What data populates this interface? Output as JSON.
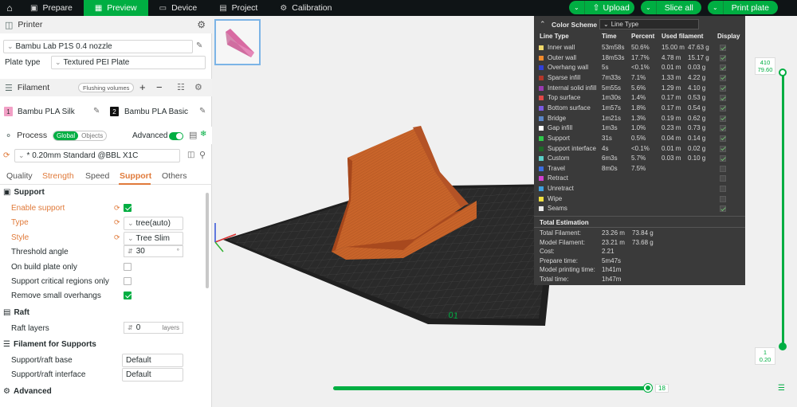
{
  "topbar": {
    "tabs": [
      {
        "label": "Prepare",
        "icon": "cube-icon"
      },
      {
        "label": "Preview",
        "icon": "preview-icon",
        "active": true
      },
      {
        "label": "Device",
        "icon": "monitor-icon"
      },
      {
        "label": "Project",
        "icon": "project-icon"
      },
      {
        "label": "Calibration",
        "icon": "gear-icon"
      }
    ],
    "upload_label": "Upload",
    "slice_label": "Slice all",
    "print_label": "Print plate"
  },
  "printer": {
    "section_title": "Printer",
    "printer_name": "Bambu Lab P1S 0.4 nozzle",
    "plate_label": "Plate type",
    "plate_value": "Textured PEI Plate"
  },
  "filament": {
    "section_title": "Filament",
    "flushing_label": "Flushing volumes",
    "items": [
      {
        "index": "1",
        "name": "Bambu PLA Silk",
        "color": "#f2a0c6"
      },
      {
        "index": "2",
        "name": "Bambu PLA Basic",
        "color": "#111111"
      }
    ]
  },
  "process": {
    "section_title": "Process",
    "global_label": "Global",
    "objects_label": "Objects",
    "advanced_label": "Advanced",
    "preset": "* 0.20mm Standard @BBL X1C"
  },
  "tabs": [
    "Quality",
    "Strength",
    "Speed",
    "Support",
    "Others"
  ],
  "support": {
    "title": "Support",
    "enable_label": "Enable support",
    "type_label": "Type",
    "type_value": "tree(auto)",
    "style_label": "Style",
    "style_value": "Tree Slim",
    "threshold_label": "Threshold angle",
    "threshold_value": "30",
    "threshold_unit": "°",
    "on_plate_label": "On build plate only",
    "critical_label": "Support critical regions only",
    "remove_label": "Remove small overhangs"
  },
  "raft": {
    "title": "Raft",
    "layers_label": "Raft layers",
    "layers_value": "0",
    "layers_unit": "layers"
  },
  "filament_supports": {
    "title": "Filament for Supports",
    "base_label": "Support/raft base",
    "base_value": "Default",
    "interface_label": "Support/raft interface",
    "interface_value": "Default"
  },
  "advanced_section": {
    "title": "Advanced"
  },
  "color_scheme": {
    "title": "Color Scheme",
    "select_value": "Line Type",
    "headers": [
      "Line Type",
      "Time",
      "Percent",
      "Used filament",
      "Display"
    ],
    "rows": [
      {
        "name": "Inner wall",
        "color": "#f0d86a",
        "time": "53m58s",
        "percent": "50.6%",
        "len": "15.00 m",
        "weight": "47.63 g",
        "display": true
      },
      {
        "name": "Outer wall",
        "color": "#f08a2c",
        "time": "18m53s",
        "percent": "17.7%",
        "len": "4.78 m",
        "weight": "15.17 g",
        "display": true
      },
      {
        "name": "Overhang wall",
        "color": "#2f40d8",
        "time": "5s",
        "percent": "<0.1%",
        "len": "0.01 m",
        "weight": "0.03 g",
        "display": true
      },
      {
        "name": "Sparse infill",
        "color": "#b3362a",
        "time": "7m33s",
        "percent": "7.1%",
        "len": "1.33 m",
        "weight": "4.22 g",
        "display": true
      },
      {
        "name": "Internal solid infill",
        "color": "#9a3ab0",
        "time": "5m55s",
        "percent": "5.6%",
        "len": "1.29 m",
        "weight": "4.10 g",
        "display": true
      },
      {
        "name": "Top surface",
        "color": "#e04848",
        "time": "1m30s",
        "percent": "1.4%",
        "len": "0.17 m",
        "weight": "0.53 g",
        "display": true
      },
      {
        "name": "Bottom surface",
        "color": "#7a5ae0",
        "time": "1m57s",
        "percent": "1.8%",
        "len": "0.17 m",
        "weight": "0.54 g",
        "display": true
      },
      {
        "name": "Bridge",
        "color": "#5a86c8",
        "time": "1m21s",
        "percent": "1.3%",
        "len": "0.19 m",
        "weight": "0.62 g",
        "display": true
      },
      {
        "name": "Gap infill",
        "color": "#ffffff",
        "time": "1m3s",
        "percent": "1.0%",
        "len": "0.23 m",
        "weight": "0.73 g",
        "display": true
      },
      {
        "name": "Support",
        "color": "#2ec84a",
        "time": "31s",
        "percent": "0.5%",
        "len": "0.04 m",
        "weight": "0.14 g",
        "display": true
      },
      {
        "name": "Support interface",
        "color": "#1e6a28",
        "time": "4s",
        "percent": "<0.1%",
        "len": "0.01 m",
        "weight": "0.02 g",
        "display": true
      },
      {
        "name": "Custom",
        "color": "#5ad0c8",
        "time": "6m3s",
        "percent": "5.7%",
        "len": "0.03 m",
        "weight": "0.10 g",
        "display": true
      },
      {
        "name": "Travel",
        "color": "#3c6ee0",
        "time": "8m0s",
        "percent": "7.5%",
        "len": "",
        "weight": "",
        "display": false
      },
      {
        "name": "Retract",
        "color": "#d040d0",
        "time": "",
        "percent": "",
        "len": "",
        "weight": "",
        "display": false
      },
      {
        "name": "Unretract",
        "color": "#40a0e0",
        "time": "",
        "percent": "",
        "len": "",
        "weight": "",
        "display": false
      },
      {
        "name": "Wipe",
        "color": "#f0e040",
        "time": "",
        "percent": "",
        "len": "",
        "weight": "",
        "display": false
      },
      {
        "name": "Seams",
        "color": "#e8e8e8",
        "time": "",
        "percent": "",
        "len": "",
        "weight": "",
        "display": true
      }
    ],
    "total_title": "Total Estimation",
    "totals": [
      {
        "label": "Total Filament:",
        "v1": "23.26 m",
        "v2": "73.84 g"
      },
      {
        "label": "Model Filament:",
        "v1": "23.21 m",
        "v2": "73.68 g"
      },
      {
        "label": "Cost:",
        "v1": "2.21",
        "v2": ""
      },
      {
        "label": "Prepare time:",
        "v1": "5m47s",
        "v2": ""
      },
      {
        "label": "Model printing time:",
        "v1": "1h41m",
        "v2": ""
      },
      {
        "label": "Total time:",
        "v1": "1h47m",
        "v2": ""
      }
    ]
  },
  "layer_slider": {
    "top_layer": "410",
    "top_height": "79.60",
    "bottom_layer": "1",
    "bottom_height": "0.20"
  },
  "move_slider": {
    "value": "18"
  },
  "bed_labels": {
    "front": "01",
    "side": "101"
  }
}
